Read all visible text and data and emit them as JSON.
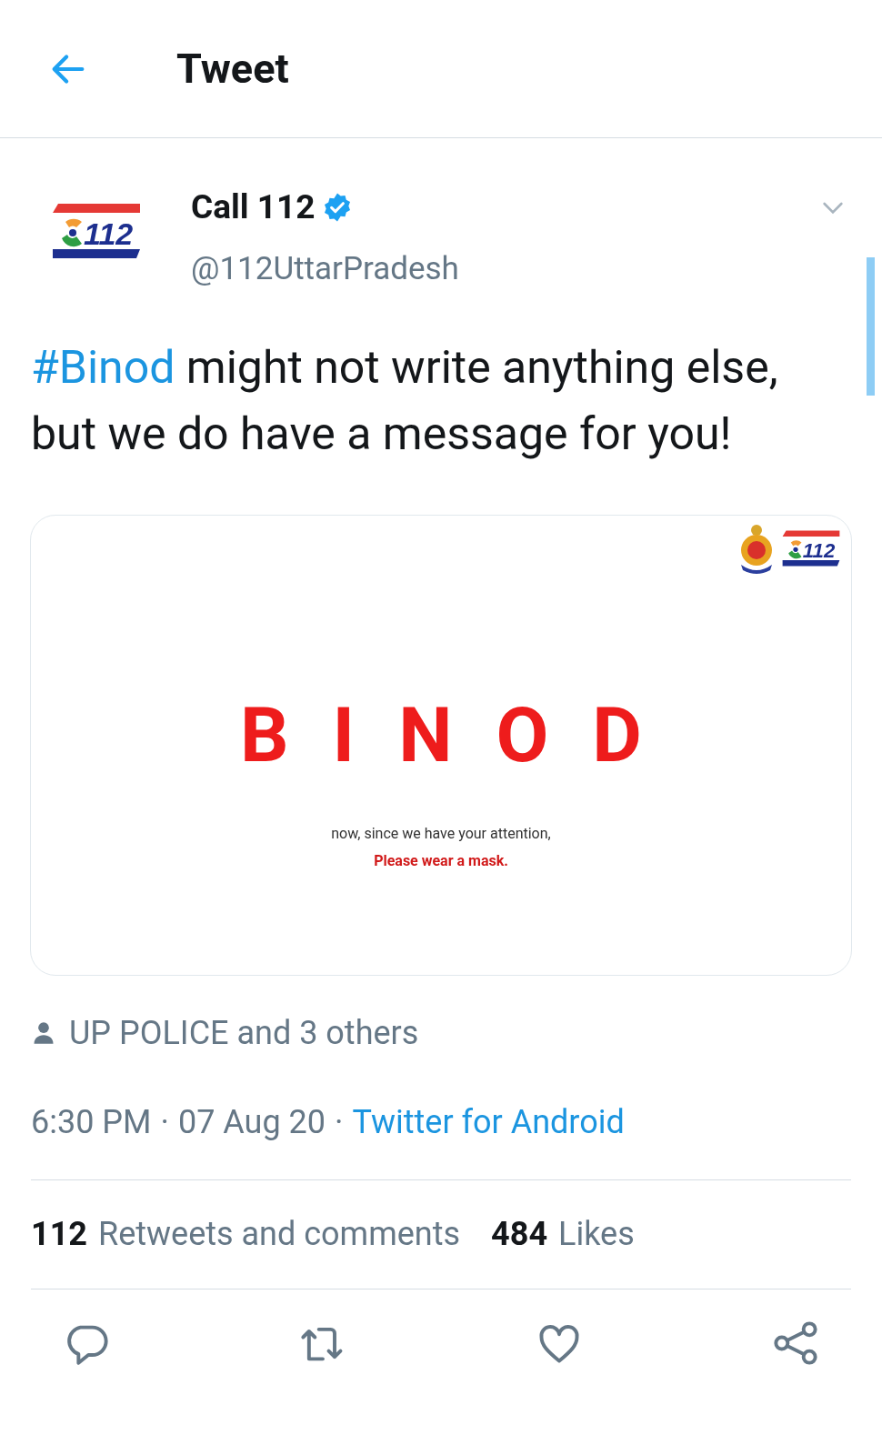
{
  "header": {
    "title": "Tweet"
  },
  "tweet": {
    "author": {
      "name": "Call 112",
      "verified": true,
      "handle": "@112UttarPradesh",
      "logo_text": "112"
    },
    "text_parts": [
      {
        "kind": "hashtag",
        "text": "#Binod"
      },
      {
        "kind": "plain",
        "text": " might not write anything else, but we do have a message for you!"
      }
    ],
    "media": {
      "logo_text": "112",
      "headline": "BINOD",
      "caption": "now, since we have your attention,",
      "notice": "Please wear a mask."
    },
    "liked_by": "UP POLICE and 3 others",
    "meta": [
      {
        "kind": "plain",
        "text": "6:30 PM"
      },
      {
        "kind": "separator",
        "text": "·"
      },
      {
        "kind": "plain",
        "text": "07 Aug 20"
      },
      {
        "kind": "separator",
        "text": "·"
      },
      {
        "kind": "link",
        "text": "Twitter for Android"
      }
    ],
    "stats": [
      {
        "count": "112",
        "label": "Retweets and comments"
      },
      {
        "count": "484",
        "label": "Likes"
      }
    ],
    "actions": [
      {
        "kind": "reply"
      },
      {
        "kind": "retweet"
      },
      {
        "kind": "like"
      },
      {
        "kind": "share"
      }
    ]
  }
}
